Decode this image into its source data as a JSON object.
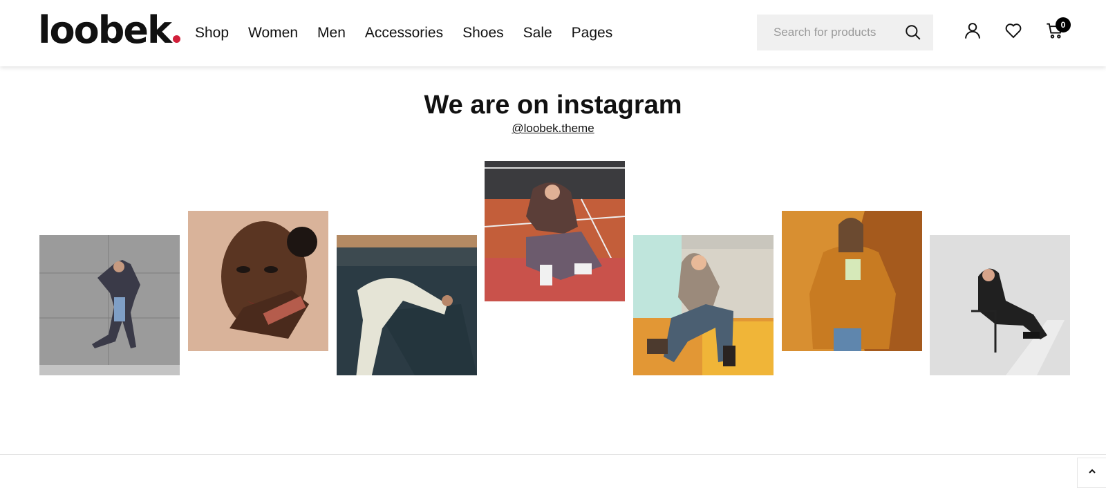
{
  "header": {
    "logo_text": "loobek",
    "brand_accent_color": "#d11f3a",
    "nav": [
      {
        "label": "Shop"
      },
      {
        "label": "Women"
      },
      {
        "label": "Men"
      },
      {
        "label": "Accessories"
      },
      {
        "label": "Shoes"
      },
      {
        "label": "Sale"
      },
      {
        "label": "Pages"
      }
    ],
    "search": {
      "placeholder": "Search for products",
      "icon": "search-icon"
    },
    "account_icon": "user-icon",
    "wishlist_icon": "heart-icon",
    "cart": {
      "icon": "cart-icon",
      "count": "0"
    }
  },
  "instagram": {
    "title": "We are on instagram",
    "handle": "@loobek.theme",
    "photos": [
      {
        "alt": "Woman dancing in checked shirt against concrete wall"
      },
      {
        "alt": "Portrait of woman holding cosmetic tube"
      },
      {
        "alt": "Woman in white outfit lying on industrial structure"
      },
      {
        "alt": "Woman in brown hoodie sitting on sports court"
      },
      {
        "alt": "Woman in sweater sitting on yellow ledge"
      },
      {
        "alt": "Woman in mustard jacket against orange wall"
      },
      {
        "alt": "Woman sitting on a chair in white studio"
      }
    ]
  },
  "scroll_top_icon": "chevron-up-icon"
}
